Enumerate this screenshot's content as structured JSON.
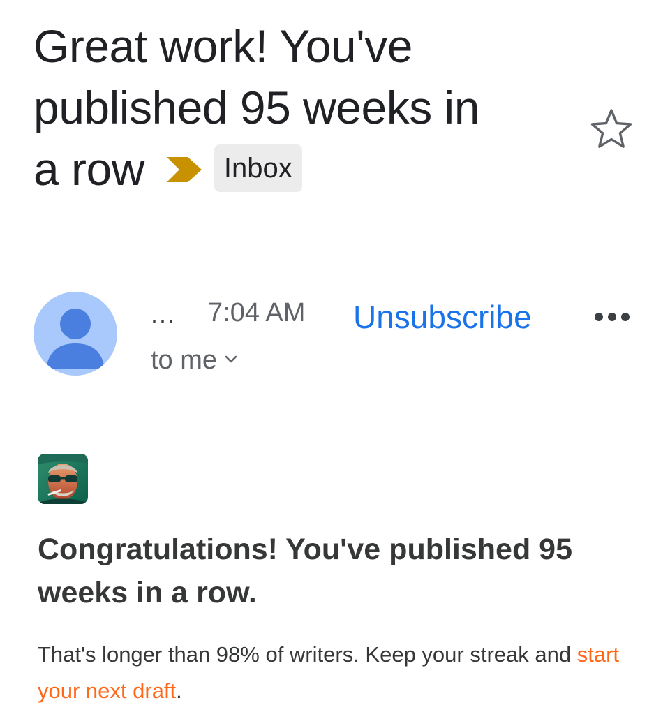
{
  "subject": {
    "line1": "Great work! You've",
    "line2": "published 95 weeks in",
    "line3": "a row",
    "label": "Inbox",
    "importance_color": "#c89100"
  },
  "sender": {
    "name": "...",
    "time": "7:04 AM",
    "unsubscribe": "Unsubscribe",
    "recipient": "to me",
    "avatar_color": "#a9c8fb",
    "avatar_figure_color": "#4a7fe0"
  },
  "email_body": {
    "title": "Congratulations! You've published 95 weeks in a row.",
    "text_before_link": "That's longer than 98% of writers. Keep your streak and ",
    "link_text": "start your next draft",
    "text_after_link": ".",
    "link_color": "#ff6719"
  },
  "icons": {
    "star": "star-outline-icon",
    "importance": "important-marker-icon",
    "more": "more-horizontal-icon",
    "expand": "chevron-down-icon"
  }
}
